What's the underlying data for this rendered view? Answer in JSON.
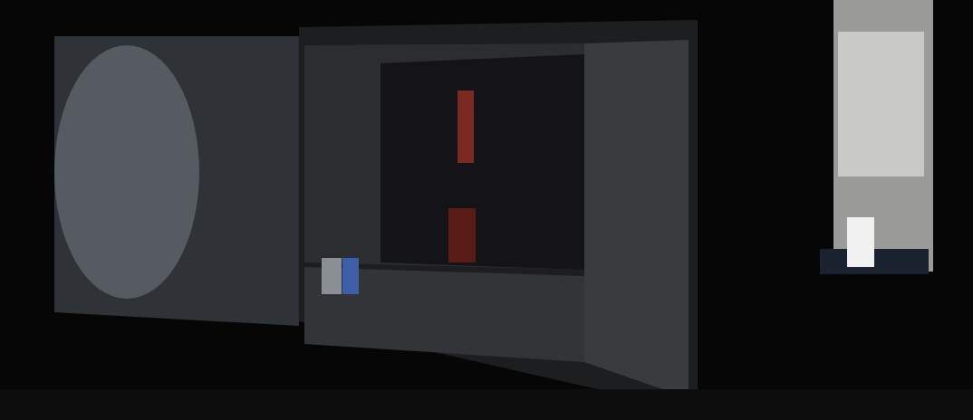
{
  "photo": {
    "kind": "monitors"
  }
}
